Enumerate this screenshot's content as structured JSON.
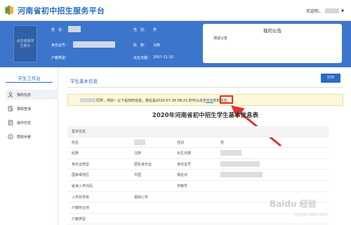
{
  "header": {
    "app_title": "河南省初中招生服务平台",
    "welcome": "欢迎你，"
  },
  "profile": {
    "photo_text_line1": "点击查看学",
    "photo_text_line2": "生照片",
    "name_label": "姓　名：",
    "gender_label": "性　别：",
    "gender_value": "男",
    "id_label": "身份证号：",
    "ethnic_label": "民　族：",
    "ethnic_value": "汉族",
    "hukou_label": "户籍类型：",
    "birth_label": "出生日期：",
    "birth_value": "2007-11-15"
  },
  "notice": {
    "title": "我的公告",
    "items": [
      "测试公告"
    ]
  },
  "sidebar": {
    "title": "学生工作台",
    "items": [
      {
        "label": "我的信息",
        "icon": "user-icon",
        "active": true
      },
      {
        "label": "录取查询",
        "icon": "search-doc-icon",
        "active": false
      },
      {
        "label": "操作日志",
        "icon": "log-icon",
        "active": false
      },
      {
        "label": "帮助手册",
        "icon": "info-icon",
        "active": false
      }
    ]
  },
  "main": {
    "section_title": "学生基本信息",
    "print_label": "打印",
    "alert_prefix": "同学，你好！以下是你的信息，我在是2020-07-26 08:21,你可以点击",
    "alert_link": "修改",
    "alert_suffix": "你的信息。",
    "form_title": "2020年河南省初中招生学生基本信息表"
  },
  "table": {
    "section_label": "基本信息",
    "rows": [
      [
        "姓名",
        "",
        "性别",
        "男"
      ],
      [
        "民族",
        "汉族",
        "出生日期",
        ""
      ],
      [
        "身份证类型",
        "居民身份证",
        "身份证号",
        ""
      ],
      [
        "国家或地区",
        "中国",
        "报名点",
        ""
      ],
      [
        "就读入学代码",
        "",
        "学籍号",
        ""
      ],
      [
        "入学前学校",
        "莆田小学",
        "",
        ""
      ],
      [
        "户籍所在地",
        "",
        "",
        ""
      ],
      [
        "户籍类型",
        "",
        "",
        ""
      ]
    ]
  },
  "watermark": {
    "text": "Baidu 经验",
    "sub": "jingyan.baidu.com"
  },
  "colors": {
    "primary": "#2a6cc4",
    "banner": "#3b76cc",
    "alert_bg": "#fdf8d9",
    "highlight": "#e03030"
  }
}
